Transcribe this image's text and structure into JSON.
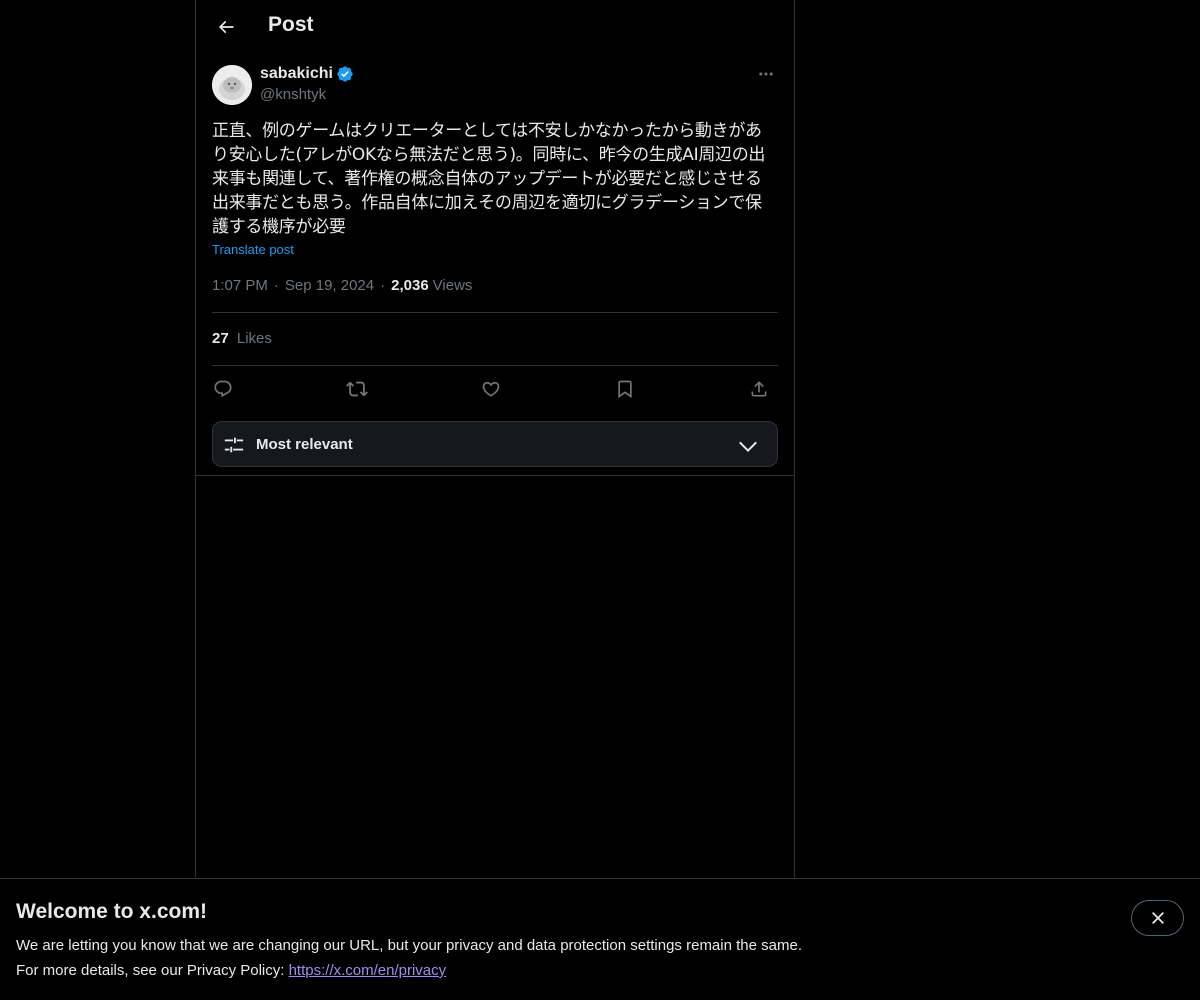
{
  "header": {
    "title": "Post",
    "back_icon": "arrow-left-icon"
  },
  "post": {
    "author": {
      "name": "sabakichi",
      "handle": "@knshtyk",
      "verified": true,
      "verified_color": "#1d9bf0"
    },
    "text": "正直、例のゲームはクリエーターとしては不安しかなかったから動きがあり安心した(アレがOKなら無法だと思う)。同時に、昨今の生成AI周辺の出来事も関連して、著作権の概念自体のアップデートが必要だと感じさせる出来事だとも思う。作品自体に加えその周辺を適切にグラデーションで保護する機序が必要",
    "translate_label": "Translate post",
    "time": "1:07 PM",
    "date": "Sep 19, 2024",
    "views_count": "2,036",
    "views_label": "Views",
    "likes_count": "27",
    "likes_label": "Likes",
    "separator": "·"
  },
  "actions": [
    {
      "icon": "reply-icon"
    },
    {
      "icon": "repost-icon"
    },
    {
      "icon": "like-icon"
    },
    {
      "icon": "bookmark-icon"
    },
    {
      "icon": "share-icon"
    }
  ],
  "sort": {
    "label": "Most relevant",
    "icon": "sliders-icon"
  },
  "banner": {
    "title": "Welcome to x.com!",
    "line1": "We are letting you know that we are changing our URL, but your privacy and data protection settings remain the same.",
    "line2_prefix": "For more details, see our Privacy Policy: ",
    "link": "https://x.com/en/privacy"
  },
  "colors": {
    "background": "#000000",
    "text": "#e7e9ea",
    "muted": "#71767b",
    "accent": "#1d9bf0",
    "border": "#2f3336"
  }
}
